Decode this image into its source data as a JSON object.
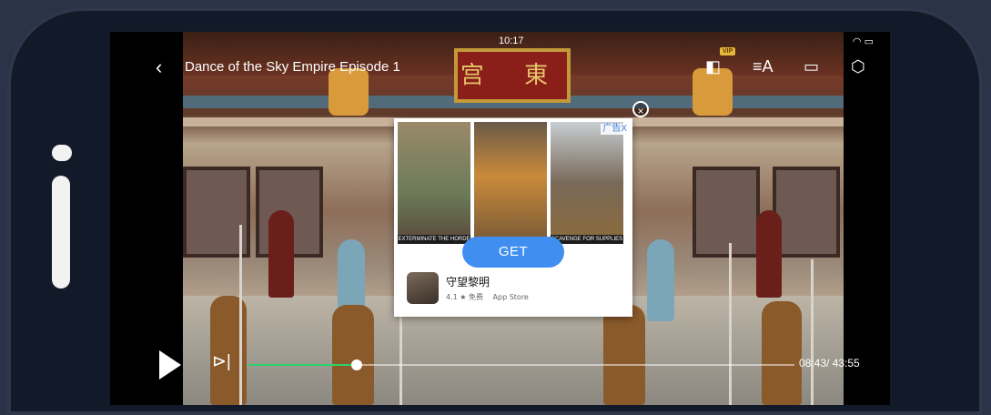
{
  "player": {
    "status_time": "10:17",
    "title": "Dance of the Sky Empire Episode 1",
    "vip_badge": "VIP",
    "time_current": "08:43",
    "time_total": "43:55",
    "time_separator": "/ ",
    "progress_fraction": 0.198
  },
  "video_scene": {
    "plaque_text": "宫 東"
  },
  "ad": {
    "tag": "广告X",
    "get_label": "GET",
    "app_name": "守望黎明",
    "app_rating": "4.1 ★ 免费",
    "app_store": "App Store",
    "caption_left": "EXTERMINATE THE HORDE",
    "caption_right": "SCAVENGE FOR SUPPLIES"
  },
  "icons": {
    "back": "chevron-left-icon",
    "dolby": "dolby-icon",
    "subtitles": "subtitle-icon",
    "screen": "screen-mirror-icon",
    "settings": "settings-icon",
    "play": "play-icon",
    "next": "next-episode-icon",
    "close": "close-icon"
  },
  "colors": {
    "progress": "#2bd26a",
    "ad_button": "#3f8ef0",
    "phone_frame": "#121a2a"
  }
}
